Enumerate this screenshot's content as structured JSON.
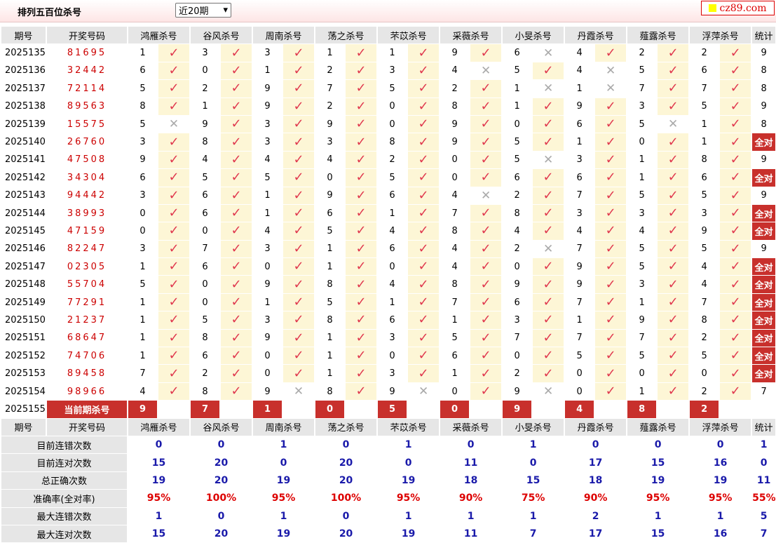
{
  "page_title": "排列五百位杀号",
  "period_select": {
    "value": "近20期",
    "arrow": "▾"
  },
  "logo": {
    "text": "cz89.com"
  },
  "header": {
    "period": "期号",
    "draw": "开奖号码",
    "experts": [
      "鸿雁杀号",
      "谷风杀号",
      "周南杀号",
      "荡之杀号",
      "芣苡杀号",
      "采薇杀号",
      "小旻杀号",
      "丹霞杀号",
      "薤露杀号",
      "浮萍杀号"
    ],
    "stat": "统计"
  },
  "mark_right": "✓",
  "mark_wrong": "✕",
  "rows": [
    {
      "period": "2025135",
      "draw": "81695",
      "kills": [
        1,
        3,
        3,
        1,
        1,
        9,
        6,
        4,
        2,
        2
      ],
      "ok": [
        1,
        1,
        1,
        1,
        1,
        1,
        0,
        1,
        1,
        1
      ],
      "stat": "9"
    },
    {
      "period": "2025136",
      "draw": "32442",
      "kills": [
        6,
        0,
        1,
        2,
        3,
        4,
        5,
        4,
        5,
        6
      ],
      "ok": [
        1,
        1,
        1,
        1,
        1,
        0,
        1,
        0,
        1,
        1
      ],
      "stat": "8"
    },
    {
      "period": "2025137",
      "draw": "72114",
      "kills": [
        5,
        2,
        9,
        7,
        5,
        2,
        1,
        1,
        7,
        7
      ],
      "ok": [
        1,
        1,
        1,
        1,
        1,
        1,
        0,
        0,
        1,
        1
      ],
      "stat": "8"
    },
    {
      "period": "2025138",
      "draw": "89563",
      "kills": [
        8,
        1,
        9,
        2,
        0,
        8,
        1,
        9,
        3,
        5
      ],
      "ok": [
        1,
        1,
        1,
        1,
        1,
        1,
        1,
        1,
        1,
        1
      ],
      "stat": "9"
    },
    {
      "period": "2025139",
      "draw": "15575",
      "kills": [
        5,
        9,
        3,
        9,
        0,
        9,
        0,
        6,
        5,
        1
      ],
      "ok": [
        0,
        1,
        1,
        1,
        1,
        1,
        1,
        1,
        0,
        1
      ],
      "stat": "8"
    },
    {
      "period": "2025140",
      "draw": "26760",
      "kills": [
        3,
        8,
        3,
        3,
        8,
        9,
        5,
        1,
        0,
        1
      ],
      "ok": [
        1,
        1,
        1,
        1,
        1,
        1,
        1,
        1,
        1,
        1
      ],
      "stat": "全对"
    },
    {
      "period": "2025141",
      "draw": "47508",
      "kills": [
        9,
        4,
        4,
        4,
        2,
        0,
        5,
        3,
        1,
        8
      ],
      "ok": [
        1,
        1,
        1,
        1,
        1,
        1,
        0,
        1,
        1,
        1
      ],
      "stat": "9"
    },
    {
      "period": "2025142",
      "draw": "34304",
      "kills": [
        6,
        5,
        5,
        0,
        5,
        0,
        6,
        6,
        1,
        6
      ],
      "ok": [
        1,
        1,
        1,
        1,
        1,
        1,
        1,
        1,
        1,
        1
      ],
      "stat": "全对"
    },
    {
      "period": "2025143",
      "draw": "94442",
      "kills": [
        3,
        6,
        1,
        9,
        6,
        4,
        2,
        7,
        5,
        5
      ],
      "ok": [
        1,
        1,
        1,
        1,
        1,
        0,
        1,
        1,
        1,
        1
      ],
      "stat": "9"
    },
    {
      "period": "2025144",
      "draw": "38993",
      "kills": [
        0,
        6,
        1,
        6,
        1,
        7,
        8,
        3,
        3,
        3
      ],
      "ok": [
        1,
        1,
        1,
        1,
        1,
        1,
        1,
        1,
        1,
        1
      ],
      "stat": "全对"
    },
    {
      "period": "2025145",
      "draw": "47159",
      "kills": [
        0,
        0,
        4,
        5,
        4,
        8,
        4,
        4,
        4,
        9
      ],
      "ok": [
        1,
        1,
        1,
        1,
        1,
        1,
        1,
        1,
        1,
        1
      ],
      "stat": "全对"
    },
    {
      "period": "2025146",
      "draw": "82247",
      "kills": [
        3,
        7,
        3,
        1,
        6,
        4,
        2,
        7,
        5,
        5
      ],
      "ok": [
        1,
        1,
        1,
        1,
        1,
        1,
        0,
        1,
        1,
        1
      ],
      "stat": "9"
    },
    {
      "period": "2025147",
      "draw": "02305",
      "kills": [
        1,
        6,
        0,
        1,
        0,
        4,
        0,
        9,
        5,
        4
      ],
      "ok": [
        1,
        1,
        1,
        1,
        1,
        1,
        1,
        1,
        1,
        1
      ],
      "stat": "全对"
    },
    {
      "period": "2025148",
      "draw": "55704",
      "kills": [
        5,
        0,
        9,
        8,
        4,
        8,
        9,
        9,
        3,
        4
      ],
      "ok": [
        1,
        1,
        1,
        1,
        1,
        1,
        1,
        1,
        1,
        1
      ],
      "stat": "全对"
    },
    {
      "period": "2025149",
      "draw": "77291",
      "kills": [
        1,
        0,
        1,
        5,
        1,
        7,
        6,
        7,
        1,
        7
      ],
      "ok": [
        1,
        1,
        1,
        1,
        1,
        1,
        1,
        1,
        1,
        1
      ],
      "stat": "全对"
    },
    {
      "period": "2025150",
      "draw": "21237",
      "kills": [
        1,
        5,
        3,
        8,
        6,
        1,
        3,
        1,
        9,
        8
      ],
      "ok": [
        1,
        1,
        1,
        1,
        1,
        1,
        1,
        1,
        1,
        1
      ],
      "stat": "全对"
    },
    {
      "period": "2025151",
      "draw": "68647",
      "kills": [
        1,
        8,
        9,
        1,
        3,
        5,
        7,
        7,
        7,
        2
      ],
      "ok": [
        1,
        1,
        1,
        1,
        1,
        1,
        1,
        1,
        1,
        1
      ],
      "stat": "全对"
    },
    {
      "period": "2025152",
      "draw": "74706",
      "kills": [
        1,
        6,
        0,
        1,
        0,
        6,
        0,
        5,
        5,
        5
      ],
      "ok": [
        1,
        1,
        1,
        1,
        1,
        1,
        1,
        1,
        1,
        1
      ],
      "stat": "全对"
    },
    {
      "period": "2025153",
      "draw": "89458",
      "kills": [
        7,
        2,
        0,
        1,
        3,
        1,
        2,
        0,
        0,
        0
      ],
      "ok": [
        1,
        1,
        1,
        1,
        1,
        1,
        1,
        1,
        1,
        1
      ],
      "stat": "全对"
    },
    {
      "period": "2025154",
      "draw": "98966",
      "kills": [
        4,
        8,
        9,
        8,
        9,
        0,
        9,
        0,
        1,
        2
      ],
      "ok": [
        1,
        1,
        0,
        1,
        0,
        1,
        0,
        1,
        1,
        1
      ],
      "stat": "7"
    }
  ],
  "current": {
    "period": "2025155",
    "label": "当前期杀号",
    "kills": [
      9,
      7,
      1,
      0,
      5,
      0,
      9,
      4,
      8,
      2
    ]
  },
  "summary": [
    {
      "label": "目前连错次数",
      "values": [
        "0",
        "0",
        "1",
        "0",
        "1",
        "0",
        "1",
        "0",
        "0",
        "0",
        "1"
      ],
      "red": false
    },
    {
      "label": "目前连对次数",
      "values": [
        "15",
        "20",
        "0",
        "20",
        "0",
        "11",
        "0",
        "17",
        "15",
        "16",
        "0"
      ],
      "red": false
    },
    {
      "label": "总正确次数",
      "values": [
        "19",
        "20",
        "19",
        "20",
        "19",
        "18",
        "15",
        "18",
        "19",
        "19",
        "11"
      ],
      "red": false
    },
    {
      "label": "准确率(全对率)",
      "values": [
        "95%",
        "100%",
        "95%",
        "100%",
        "95%",
        "90%",
        "75%",
        "90%",
        "95%",
        "95%",
        "55%"
      ],
      "red": true
    },
    {
      "label": "最大连错次数",
      "values": [
        "1",
        "0",
        "1",
        "0",
        "1",
        "1",
        "1",
        "2",
        "1",
        "1",
        "5"
      ],
      "red": false
    },
    {
      "label": "最大连对次数",
      "values": [
        "15",
        "20",
        "19",
        "20",
        "19",
        "11",
        "7",
        "17",
        "15",
        "16",
        "7"
      ],
      "red": false
    }
  ]
}
